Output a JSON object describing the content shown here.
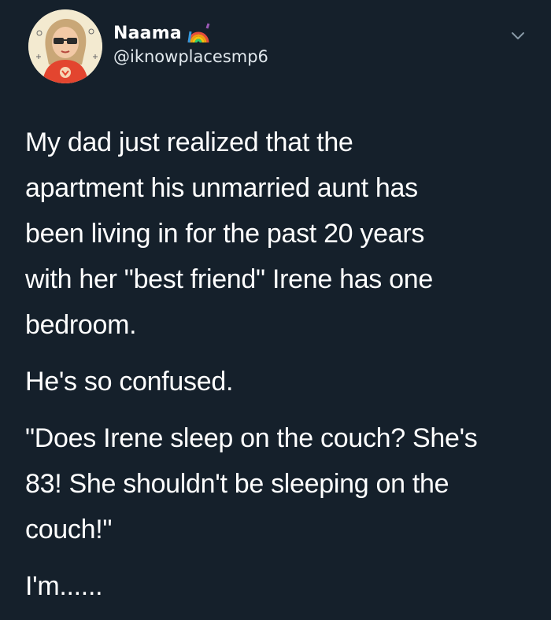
{
  "user": {
    "display_name": "Naama",
    "handle": "@iknowplacesmp6",
    "name_emoji": "rainbow-icon"
  },
  "tweet": {
    "paragraphs": [
      {
        "lines": [
          "My dad just realized that the",
          "apartment his unmarried aunt has",
          "been living in for the past 20 years",
          "with her \"best friend\" Irene has one",
          "bedroom."
        ]
      },
      {
        "lines": [
          "He's so confused."
        ]
      },
      {
        "lines": [
          "\"Does Irene sleep on the couch? She's",
          "83! She shouldn't be sleeping on the",
          "couch!\""
        ]
      },
      {
        "lines": [
          "I'm......"
        ]
      }
    ]
  },
  "colors": {
    "background": "#15202b",
    "text": "#ffffff",
    "secondary_text": "#e1e8ed",
    "chevron": "#8899a6"
  }
}
